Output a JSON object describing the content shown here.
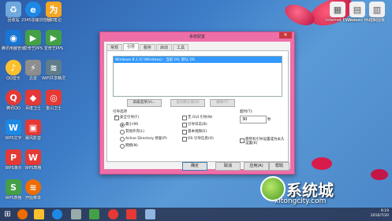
{
  "desktop_icons": [
    {
      "label": "回收站",
      "icon": "recycle-bin-icon",
      "color": "#6fa8dc"
    },
    {
      "label": "2345加速浏览器",
      "icon": "browser-icon",
      "color": "#1e88e5"
    },
    {
      "label": "为知笔记",
      "icon": "notes-icon",
      "color": "#f5a623"
    },
    {
      "label": "腾讯电脑管家",
      "icon": "qq-manager-icon",
      "color": "#1976d2"
    },
    {
      "label": "爱奇艺PPS",
      "icon": "iqiyi-icon",
      "color": "#43a047"
    },
    {
      "label": "QQ音乐",
      "icon": "qq-music-icon",
      "color": "#fbc02d"
    },
    {
      "label": "迅雷",
      "icon": "xunlei-icon",
      "color": "#8e8e8e"
    },
    {
      "label": "WiFi共享精灵",
      "icon": "wifi-icon",
      "color": "#607d8b"
    },
    {
      "label": "腾讯QQ",
      "icon": "qq-icon",
      "color": "#e53935"
    },
    {
      "label": "百度卫士",
      "icon": "guard-icon",
      "color": "#e53935"
    },
    {
      "label": "金山卫士",
      "icon": "shield-icon",
      "color": "#e53935"
    },
    {
      "label": "WPS文字",
      "icon": "wps-text-icon",
      "color": "#1e88e5"
    },
    {
      "label": "暴风影音",
      "icon": "player-icon",
      "color": "#e53935"
    },
    {
      "label": "WPS演示",
      "icon": "wps-slide-icon",
      "color": "#e53935"
    },
    {
      "label": "WPS表格",
      "icon": "wps-sheet-icon",
      "color": "#e53935"
    },
    {
      "label": "WPS表格",
      "icon": "wps-table-icon",
      "color": "#43a047"
    },
    {
      "label": "开始菜单",
      "icon": "wifi-share-icon",
      "color": "#ef6c00"
    }
  ],
  "top_right_icons": [
    {
      "label": "Internet Explorer",
      "icon": "folder-icon"
    },
    {
      "label": "Windows Media",
      "icon": "media-icon"
    },
    {
      "label": "控制面板",
      "icon": "doc-icon"
    }
  ],
  "dialog": {
    "title": "系统配置",
    "close_label": "✕",
    "tabs": [
      "常规",
      "引导",
      "服务",
      "启动",
      "工具"
    ],
    "active_tab": 1,
    "os_list": [
      "Windows 8.1 (C:\\Windows) : 当前 OS; 默认 OS"
    ],
    "advanced_button": "高级选项(V)...",
    "set_default_button": "设为默认值(D)",
    "delete_button": "删除(T)",
    "boot_options_label": "引导选项",
    "safe_boot_label": "安全引导(F)",
    "minimal_label": "最小(M)",
    "alt_shell_label": "其他外壳(L)",
    "ad_repair_label": "Active Directory 修复(P)",
    "network_label": "网络(N)",
    "no_gui_label": "无 GUI 引导(N)",
    "boot_log_label": "引导日志(B)",
    "base_video_label": "基本视频(E)",
    "os_boot_info_label": "OS 引导信息(O)",
    "timeout_label": "超时(T):",
    "timeout_value": "30",
    "seconds_label": "秒",
    "permanent_label": "使所有引导设置成为永久设置(K)",
    "ok_button": "确定",
    "cancel_button": "取消",
    "apply_button": "应用(A)",
    "help_button": "帮助"
  },
  "watermark": {
    "text": "系统城",
    "url": "xitongcity.com"
  },
  "tray": {
    "time": "9:19",
    "date": "2016/7/20"
  }
}
